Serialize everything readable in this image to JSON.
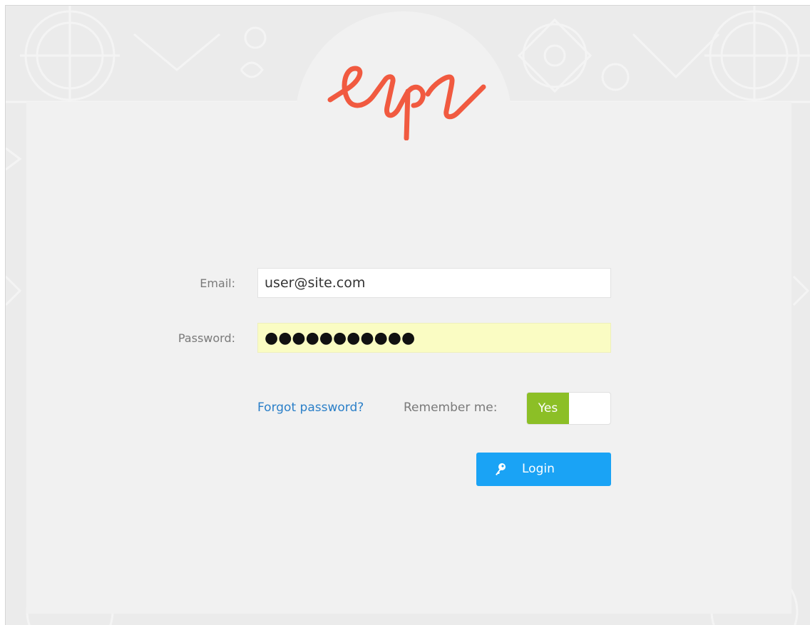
{
  "logo": {
    "icon": "epi-logo",
    "color": "#f15a40"
  },
  "form": {
    "email_label": "Email:",
    "email_value": "user@site.com",
    "password_label": "Password:",
    "password_value": "●●●●●●●●●●●"
  },
  "forgot_password": "Forgot password?",
  "remember_me": {
    "label": "Remember me:",
    "toggle_on_label": "Yes",
    "state": true,
    "color": "#8cbf26"
  },
  "login": {
    "label": "Login",
    "icon": "key-icon",
    "color": "#1aa3f5"
  }
}
